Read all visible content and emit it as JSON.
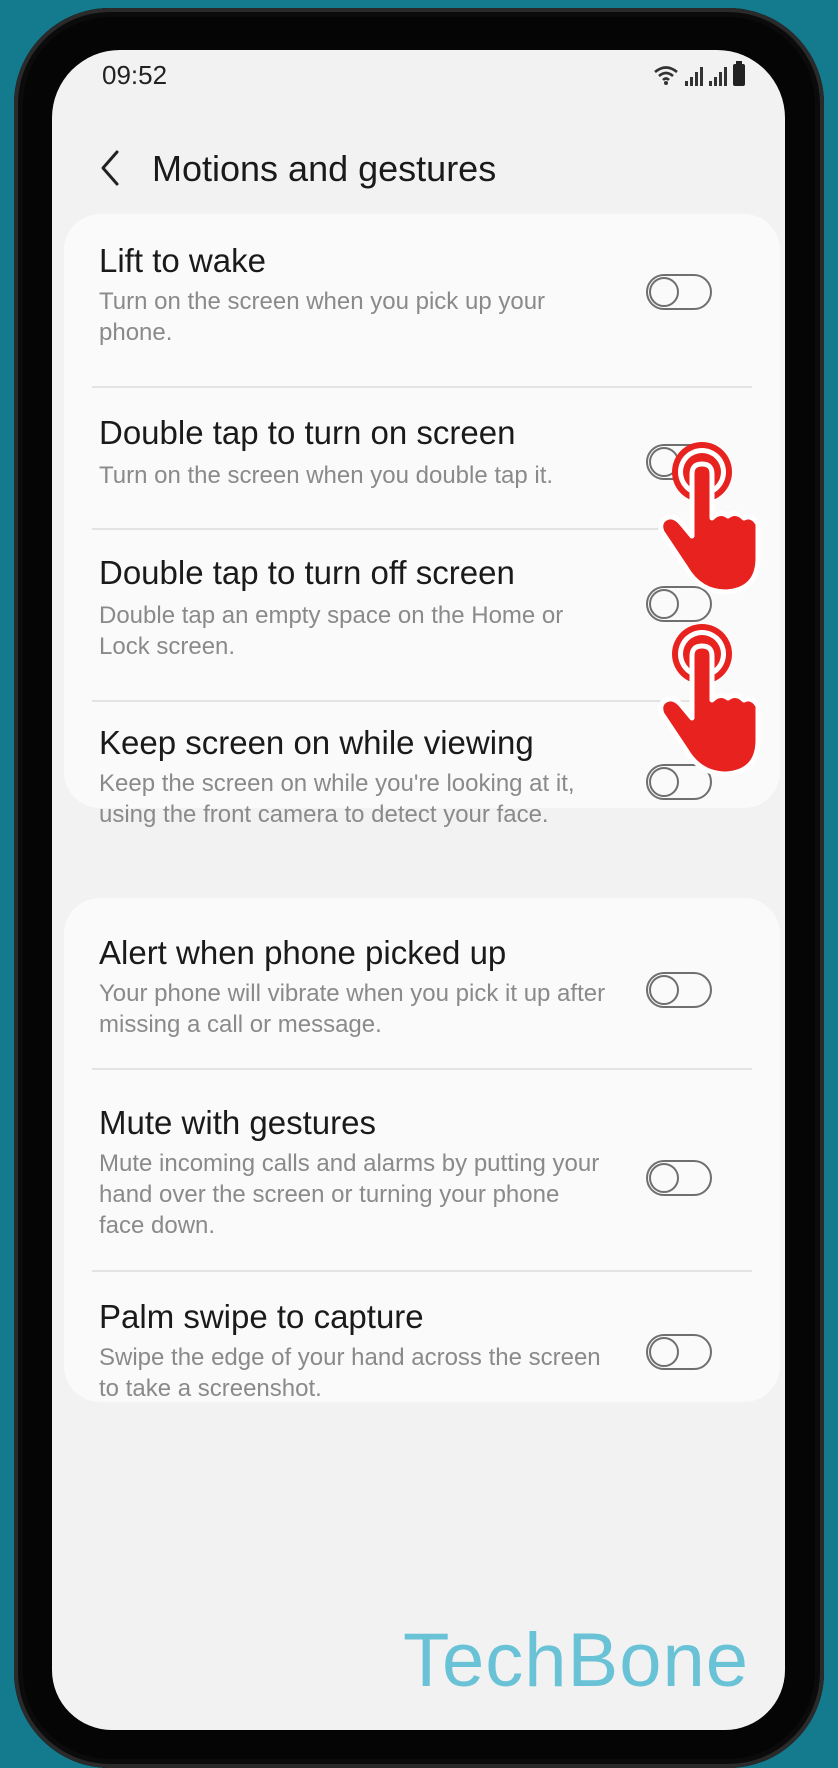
{
  "status": {
    "time": "09:52",
    "wifi_icon": "wifi-icon",
    "signal_icon": "signal-icon",
    "battery_icon": "battery-icon"
  },
  "header": {
    "back_icon": "back-arrow-icon",
    "title": "Motions and gestures"
  },
  "group1": {
    "items": [
      {
        "title": "Lift to wake",
        "description": "Turn on the screen when you pick up your phone.",
        "enabled": false
      },
      {
        "title": "Double tap to turn on screen",
        "description": "Turn on the screen when you double tap it.",
        "enabled": false
      },
      {
        "title": "Double tap to turn off screen",
        "description": "Double tap an empty space on the Home or Lock screen.",
        "enabled": false
      },
      {
        "title": "Keep screen on while viewing",
        "description": "Keep the screen on while you're looking at it, using the front camera to detect your face.",
        "enabled": false
      }
    ]
  },
  "group2": {
    "items": [
      {
        "title": "Alert when phone picked up",
        "description": "Your phone will vibrate when you pick it up after missing a call or message.",
        "enabled": false
      },
      {
        "title": "Mute with gestures",
        "description": "Mute incoming calls and alarms by putting your hand over the screen or turning your phone face down.",
        "enabled": false
      },
      {
        "title": "Palm swipe to capture",
        "description": "Swipe the edge of your hand across the screen to take a screenshot.",
        "enabled": false
      }
    ]
  },
  "overlay": {
    "tap_icon": "double-tap-hand-icon",
    "accent_color": "#e8231f"
  },
  "watermark": {
    "text": "TechBone",
    "color": "#69c2d6"
  }
}
